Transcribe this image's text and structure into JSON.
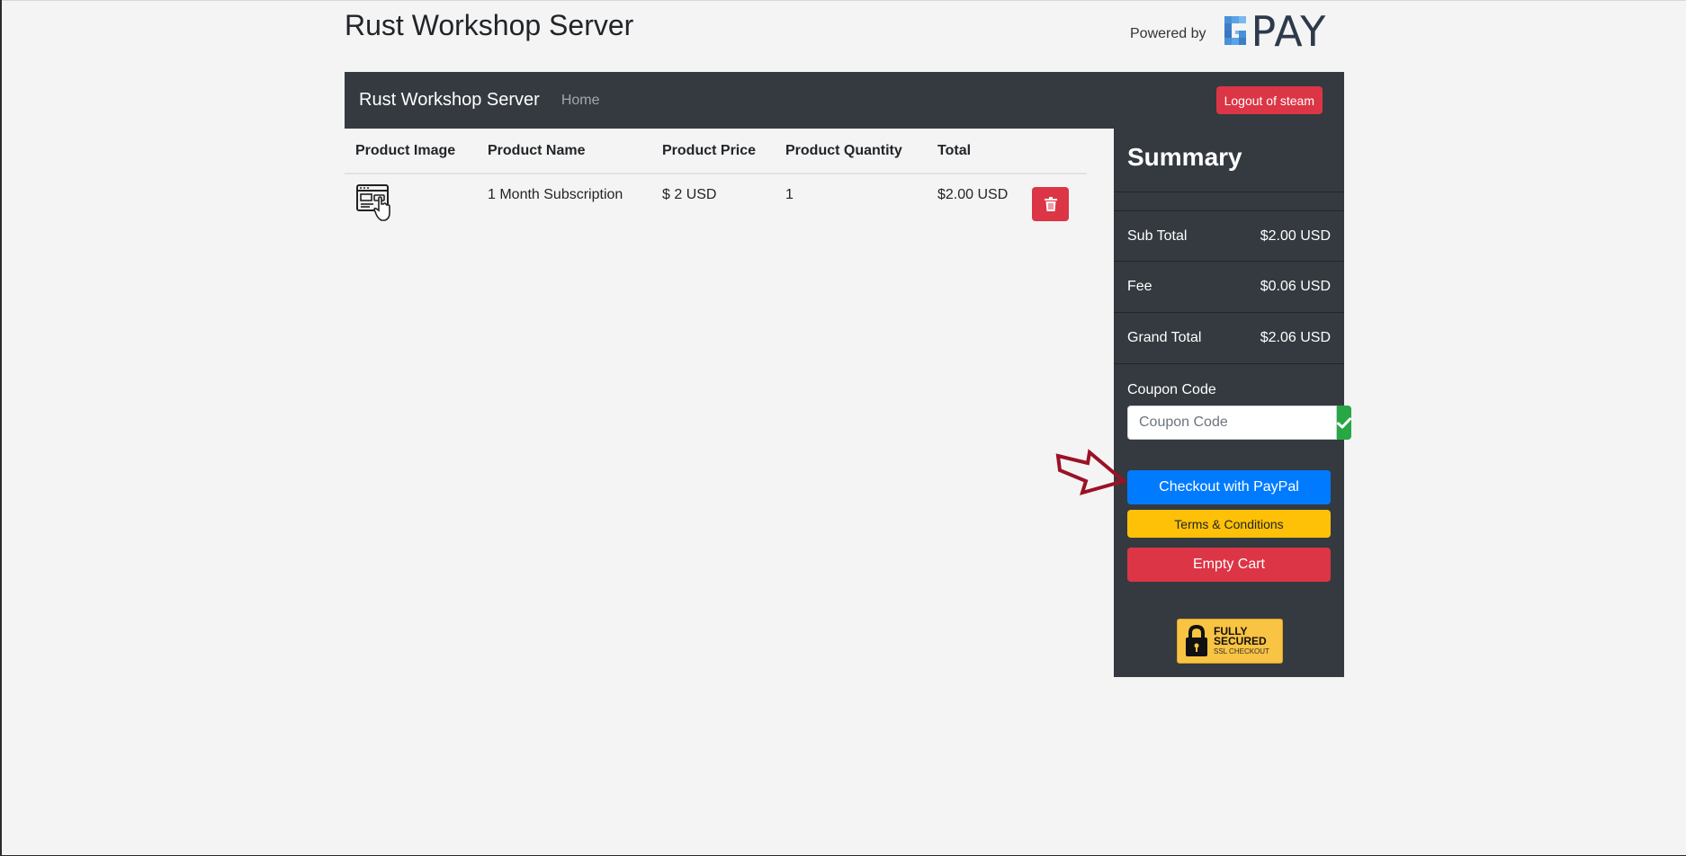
{
  "header": {
    "site_title": "Rust Workshop Server",
    "powered_by_label": "Powered by",
    "payment_logo_text": "PAY"
  },
  "navbar": {
    "brand": "Rust Workshop Server",
    "home_link": "Home",
    "logout_label": "Logout of steam"
  },
  "cart": {
    "columns": [
      "Product Image",
      "Product Name",
      "Product Price",
      "Product Quantity",
      "Total"
    ],
    "rows": [
      {
        "image_icon": "web-click-icon",
        "name": "1 Month Subscription",
        "price": "$ 2 USD",
        "quantity": "1",
        "total": "$2.00 USD"
      }
    ]
  },
  "summary": {
    "title": "Summary",
    "sub_total_label": "Sub Total",
    "sub_total_value": "$2.00 USD",
    "fee_label": "Fee",
    "fee_value": "$0.06 USD",
    "grand_total_label": "Grand Total",
    "grand_total_value": "$2.06 USD",
    "coupon_label": "Coupon Code",
    "coupon_placeholder": "Coupon Code",
    "coupon_value": "",
    "checkout_label": "Checkout with PayPal",
    "terms_label": "Terms & Conditions",
    "empty_cart_label": "Empty Cart",
    "ssl_badge": {
      "line1": "FULLY",
      "line2": "SECURED",
      "line3": "SSL CHECKOUT"
    }
  },
  "colors": {
    "navbar_bg": "#343a40",
    "danger": "#dc3545",
    "primary": "#007bff",
    "warning": "#ffc107",
    "success": "#28a745",
    "annotation_arrow": "#9b1126"
  }
}
